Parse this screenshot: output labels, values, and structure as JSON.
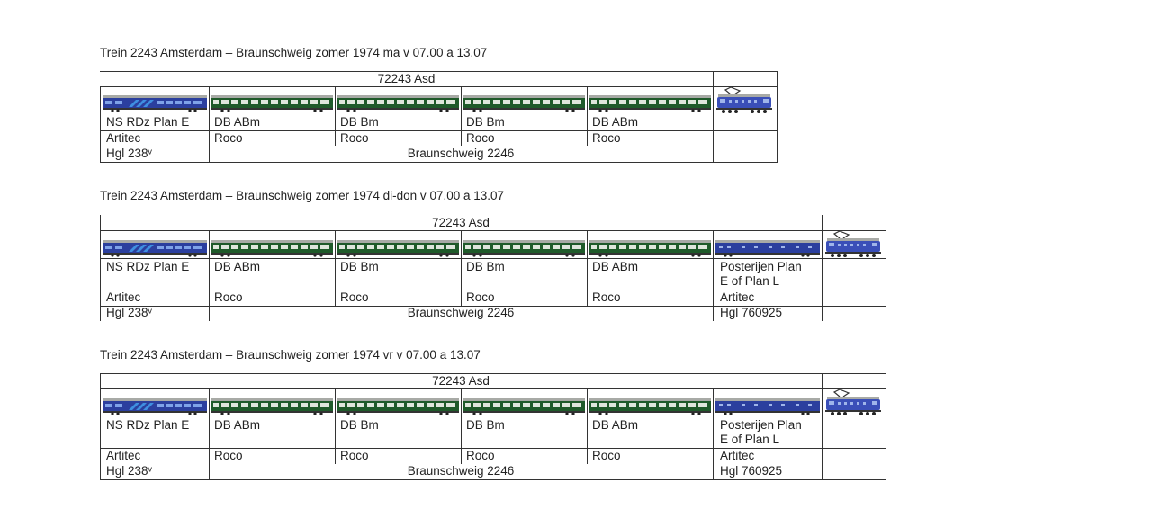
{
  "tables": [
    {
      "title": "Trein 2243 Amsterdam – Braunschweig zomer 1974 ma v 07.00 a 13.07",
      "header": "72243 Asd",
      "destination": "Braunschweig 2246",
      "cars": [
        {
          "name": "NS RDz Plan E",
          "maker": "Artitec",
          "number": "Hgl 238ᵛ",
          "image": "ns-plan-e-blue-car-icon"
        },
        {
          "name": "DB ABm",
          "maker": "Roco",
          "image": "db-green-coach-icon"
        },
        {
          "name": "DB Bm",
          "maker": "Roco",
          "image": "db-green-coach-icon"
        },
        {
          "name": "DB Bm",
          "maker": "Roco",
          "image": "db-green-coach-icon"
        },
        {
          "name": "DB ABm",
          "maker": "Roco",
          "image": "db-green-coach-icon"
        }
      ],
      "locomotive": "ns-1200-electric-loco-icon"
    },
    {
      "title": "Trein 2243 Amsterdam – Braunschweig zomer 1974 di-don v 07.00 a 13.07",
      "header": "72243 Asd",
      "destination": "Braunschweig 2246",
      "cars": [
        {
          "name": "NS RDz Plan E",
          "maker": "Artitec",
          "number": "Hgl 238ᵛ",
          "image": "ns-plan-e-blue-car-icon"
        },
        {
          "name": "DB ABm",
          "maker": "Roco",
          "image": "db-green-coach-icon"
        },
        {
          "name": "DB Bm",
          "maker": "Roco",
          "image": "db-green-coach-icon"
        },
        {
          "name": "DB Bm",
          "maker": "Roco",
          "image": "db-green-coach-icon"
        },
        {
          "name": "DB ABm",
          "maker": "Roco",
          "image": "db-green-coach-icon"
        },
        {
          "name": "Posterijen Plan E of Plan L",
          "name_line1": "Posterijen Plan",
          "name_line2": "E of Plan L",
          "maker": "Artitec",
          "number": "Hgl 760925",
          "image": "posterijen-mail-car-icon"
        }
      ],
      "locomotive": "ns-1200-electric-loco-icon"
    },
    {
      "title": "Trein 2243 Amsterdam – Braunschweig zomer 1974 vr v 07.00 a 13.07",
      "header": "72243 Asd",
      "destination": "Braunschweig 2246",
      "cars": [
        {
          "name": "NS RDz Plan E",
          "maker": "Artitec",
          "number": "Hgl 238ᵛ",
          "image": "ns-plan-e-blue-car-icon"
        },
        {
          "name": "DB ABm",
          "maker": "Roco",
          "image": "db-green-coach-icon"
        },
        {
          "name": "DB Bm",
          "maker": "Roco",
          "image": "db-green-coach-icon"
        },
        {
          "name": "DB Bm",
          "maker": "Roco",
          "image": "db-green-coach-icon"
        },
        {
          "name": "DB ABm",
          "maker": "Roco",
          "image": "db-green-coach-icon"
        },
        {
          "name": "Posterijen Plan E of Plan L",
          "name_line1": "Posterijen Plan",
          "name_line2": "E of Plan L",
          "maker": "Artitec",
          "number": "Hgl 760925",
          "image": "posterijen-mail-car-icon"
        }
      ],
      "locomotive": "ns-1200-electric-loco-icon"
    }
  ],
  "colors": {
    "ns_blue": "#2b3f9e",
    "ns_light_blue": "#3f8fe0",
    "db_green": "#1f5a2a",
    "roof_grey": "#a8aaa6",
    "loco_blue": "#3a4fb8",
    "rule": "#333333"
  }
}
